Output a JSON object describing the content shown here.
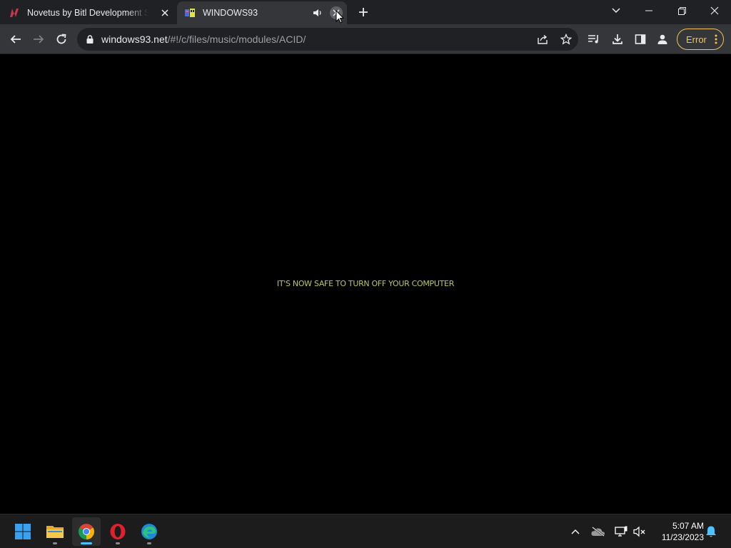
{
  "browser": {
    "tabs": [
      {
        "title": "Novetus by Bitl Development Studio",
        "favicon": "novetus-logo-icon",
        "active": false
      },
      {
        "title": "WINDOWS93",
        "favicon": "windows93-logo-icon",
        "active": true,
        "audio": "speaker-icon"
      }
    ],
    "new_tab": "plus-icon",
    "window_controls": [
      "chevron-down-icon",
      "minimize-icon",
      "restore-icon",
      "close-icon"
    ]
  },
  "toolbar": {
    "url_host": "windows93.net",
    "url_path": "/#!/c/files/music/modules/ACID/",
    "error_label": "Error"
  },
  "page": {
    "message": "IT'S NOW SAFE TO TURN OFF YOUR COMPUTER",
    "message_color": "#b7ca5a",
    "background": "#000000"
  },
  "taskbar": {
    "apps": [
      "windows-start-icon",
      "file-explorer-icon",
      "chrome-icon",
      "opera-icon",
      "edge-icon"
    ],
    "time": "5:07 AM",
    "date": "11/23/2023"
  }
}
